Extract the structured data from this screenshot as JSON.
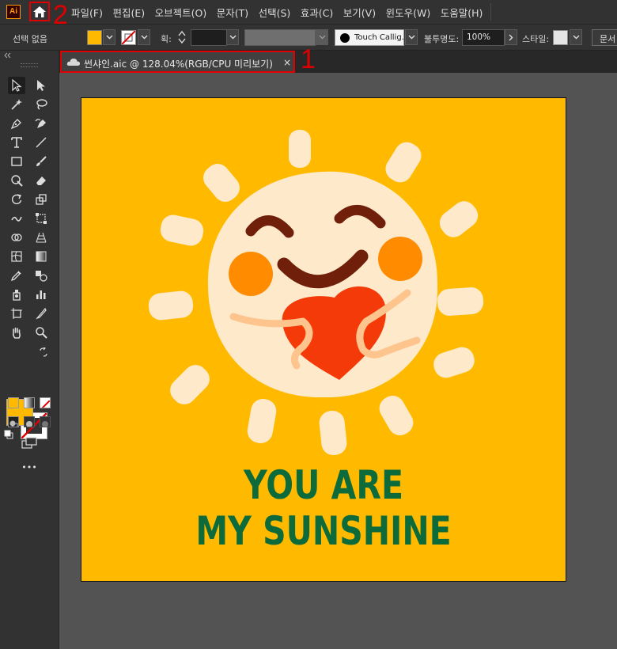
{
  "app": {
    "logo_text": "Ai"
  },
  "menu": {
    "items": [
      "파일(F)",
      "편집(E)",
      "오브젝트(O)",
      "문자(T)",
      "선택(S)",
      "효과(C)",
      "보기(V)",
      "윈도우(W)",
      "도움말(H)"
    ]
  },
  "annotations": {
    "home_marker": "2",
    "tab_marker": "1"
  },
  "control_bar": {
    "selection_status": "선택 없음",
    "stroke_label": "획:",
    "brush_name": "Touch Callig...",
    "opacity_label": "불투명도:",
    "opacity_value": "100%",
    "style_label": "스타일:",
    "document_button": "문서"
  },
  "document_tab": {
    "title": "썬샤인.aic @ 128.04%(RGB/CPU 미리보기)",
    "close_glyph": "×"
  },
  "toolbar": {
    "more_glyph": "•••"
  },
  "artwork": {
    "line1": "YOU ARE",
    "line2": "MY SUNSHINE"
  },
  "colors": {
    "fill": "#ffba00",
    "sun": "#feeacb",
    "cheeks": "#ff8c00",
    "eyes_mouth": "#70200a",
    "heart": "#f53a0a",
    "arms": "#fdc48e",
    "slogan": "#0d6a3a",
    "annotation_red": "#e10000"
  }
}
